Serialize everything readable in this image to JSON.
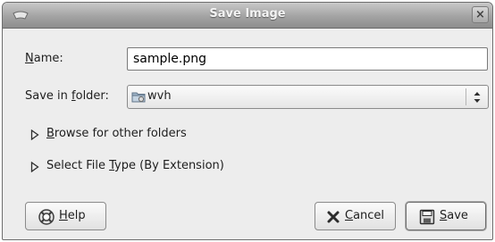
{
  "window": {
    "title": "Save Image"
  },
  "form": {
    "name_label_mnemonic": "N",
    "name_label_rest": "ame:",
    "name_value": "sample.png",
    "folder_label_prefix": "Save in ",
    "folder_label_mnemonic": "f",
    "folder_label_rest": "older:",
    "folder_value": "wvh",
    "folder_icon": "folder-icon"
  },
  "expanders": {
    "browse_mnemonic": "B",
    "browse_rest": "rowse for other folders",
    "filetype_prefix": "Select File ",
    "filetype_mnemonic": "T",
    "filetype_rest": "ype (By Extension)"
  },
  "buttons": {
    "help_mnemonic": "H",
    "help_rest": "elp",
    "cancel_mnemonic": "C",
    "cancel_rest": "ancel",
    "save_mnemonic": "S",
    "save_rest": "ave"
  },
  "icons": {
    "window_menu": "window-menu-icon",
    "close": "close-icon",
    "help": "lifebuoy-icon",
    "cancel": "cancel-x-icon",
    "save": "floppy-disk-icon"
  }
}
